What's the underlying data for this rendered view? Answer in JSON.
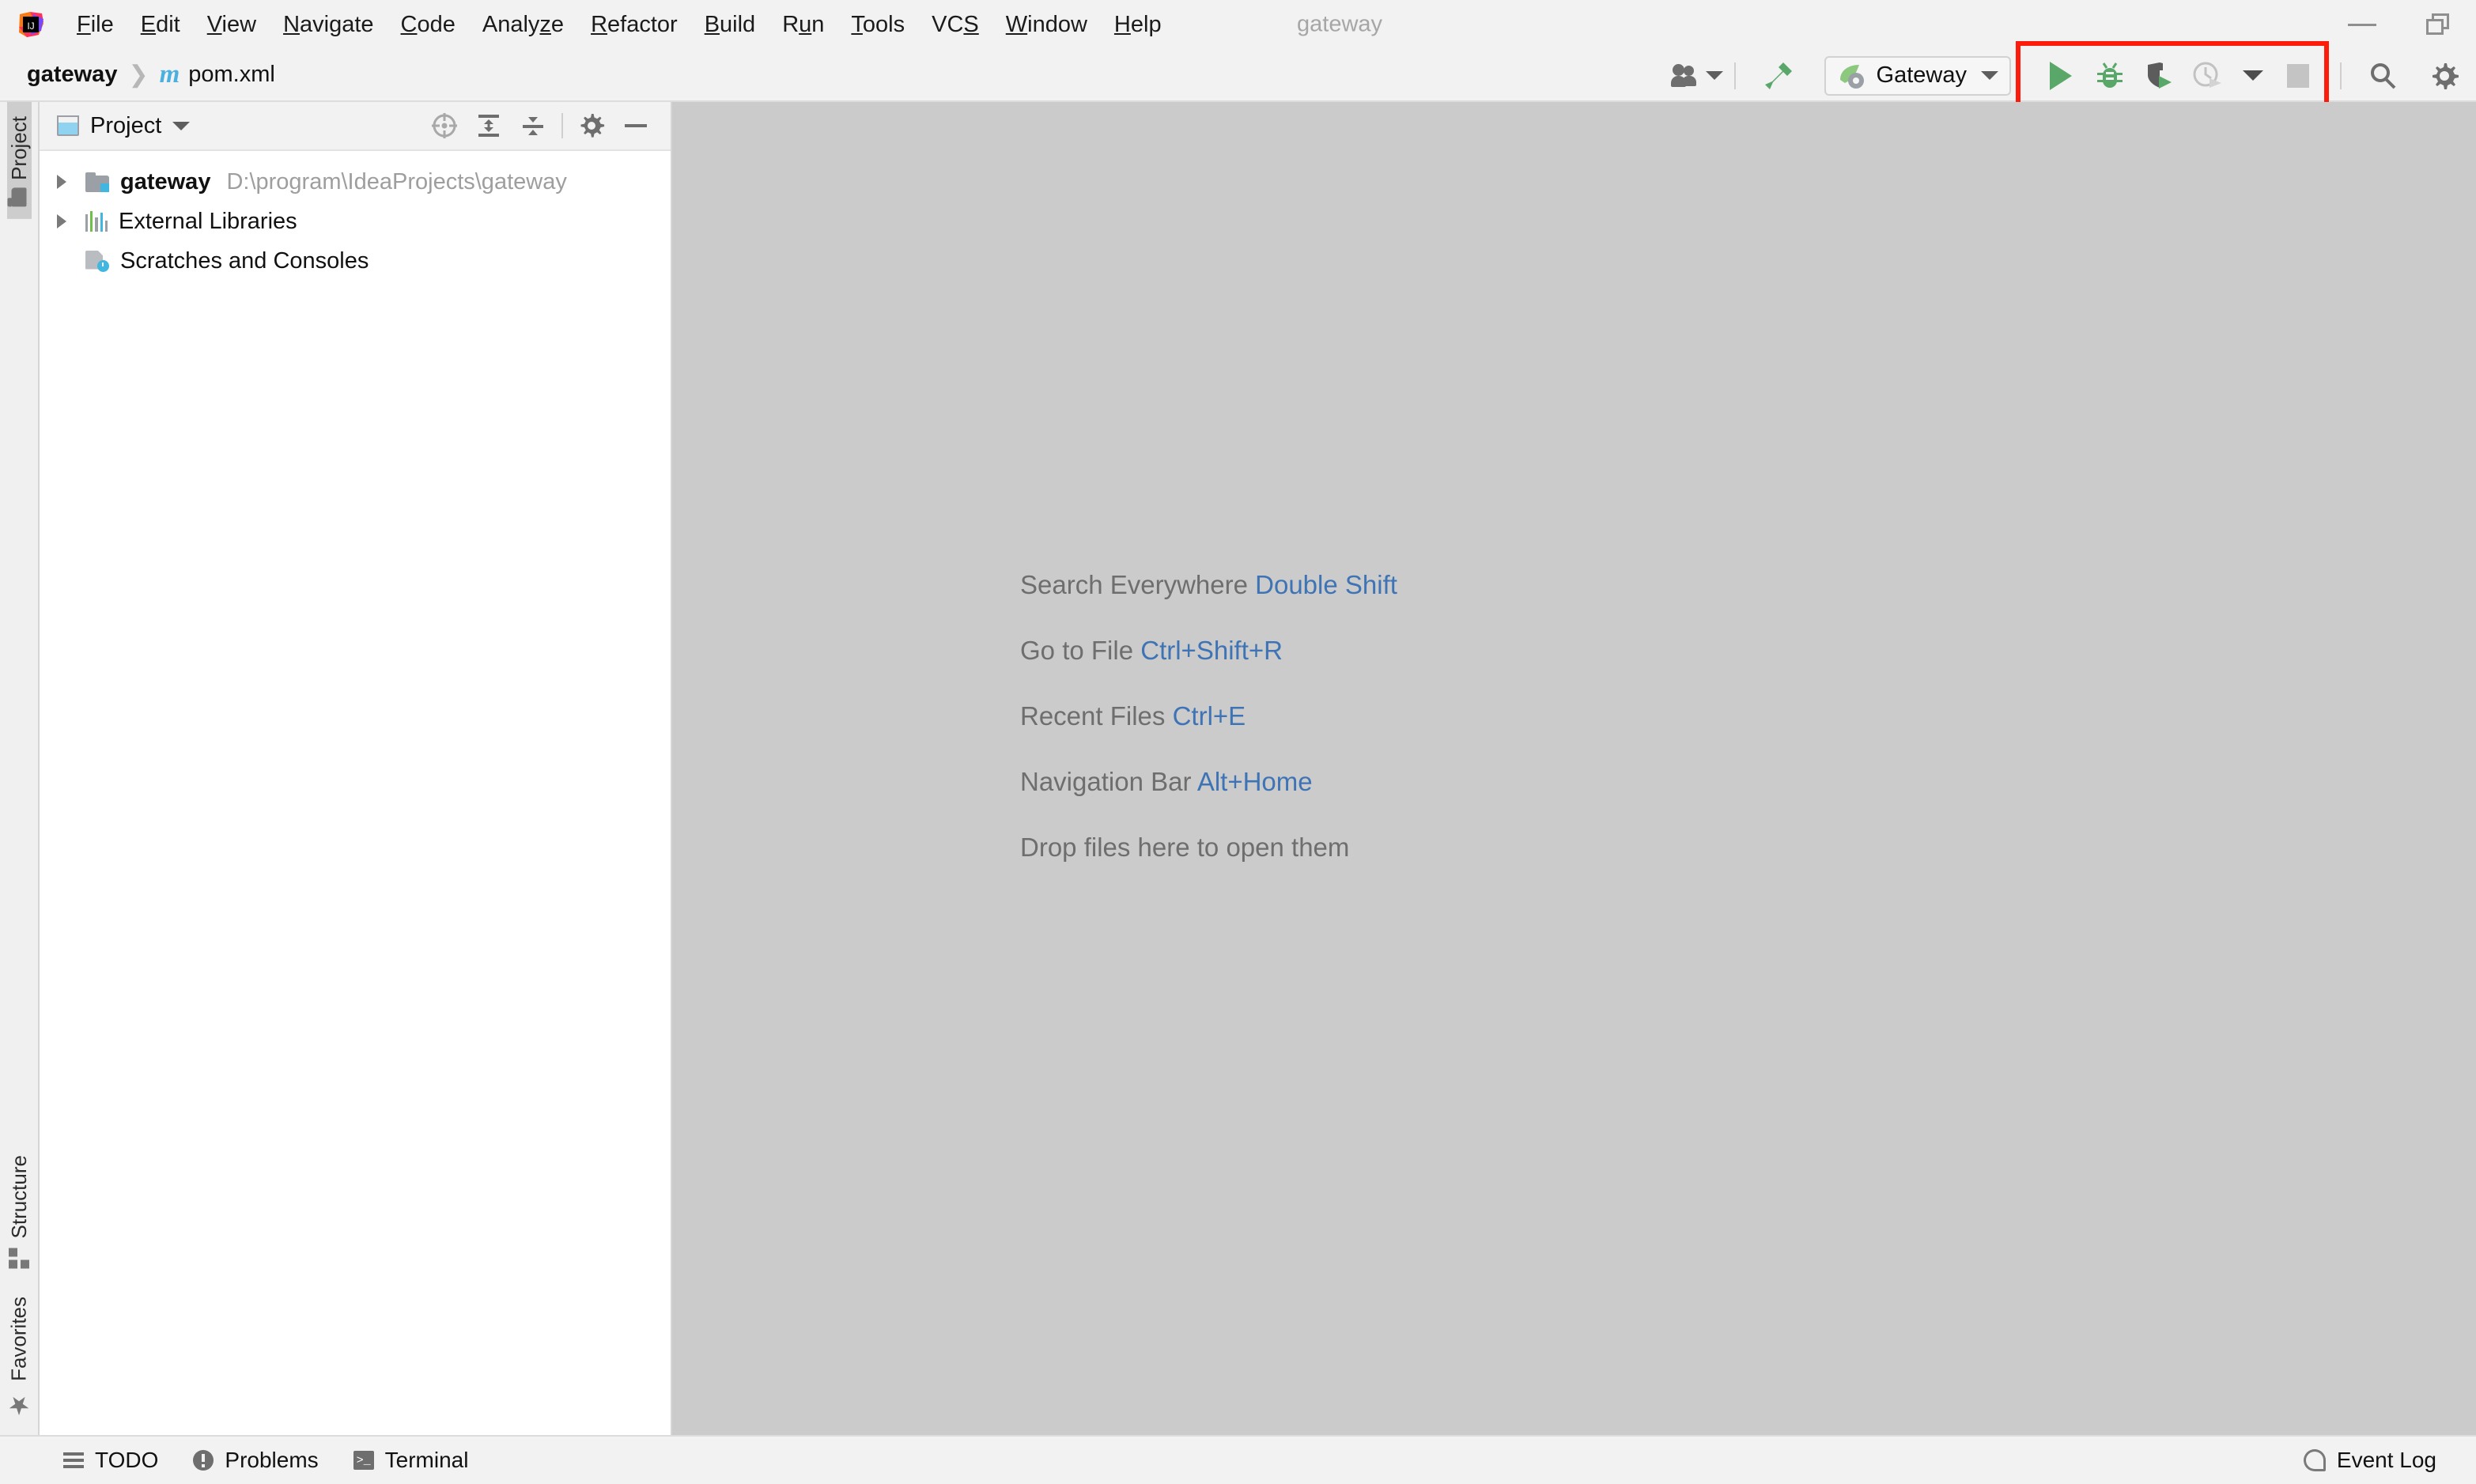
{
  "window": {
    "title": "gateway",
    "controls": [
      {
        "name": "minimize",
        "glyph": "minimize-icon"
      },
      {
        "name": "restore",
        "glyph": "restore-icon"
      }
    ]
  },
  "menubar": {
    "logo_name": "intellij-idea-logo",
    "items": [
      {
        "label": "File",
        "mnemonic": "F"
      },
      {
        "label": "Edit",
        "mnemonic": "E"
      },
      {
        "label": "View",
        "mnemonic": "V"
      },
      {
        "label": "Navigate",
        "mnemonic": "N"
      },
      {
        "label": "Code",
        "mnemonic": "C"
      },
      {
        "label": "Analyze",
        "mnemonic": "z"
      },
      {
        "label": "Refactor",
        "mnemonic": "R"
      },
      {
        "label": "Build",
        "mnemonic": "B"
      },
      {
        "label": "Run",
        "mnemonic": "u"
      },
      {
        "label": "Tools",
        "mnemonic": "T"
      },
      {
        "label": "VCS",
        "mnemonic": "S"
      },
      {
        "label": "Window",
        "mnemonic": "W"
      },
      {
        "label": "Help",
        "mnemonic": "H"
      }
    ]
  },
  "navbar": {
    "breadcrumb": {
      "root": "gateway",
      "separator": "❯",
      "file_badge": "m",
      "file": "pom.xml"
    }
  },
  "toolbar": {
    "vcs_user_icon": "person-group-icon",
    "vcs_user_caret": "chevron-down-icon",
    "build_icon": "hammer-icon",
    "run_config": {
      "icon": "spring-boot-icon",
      "label": "Gateway",
      "caret": "chevron-down-icon"
    },
    "run_controls": {
      "highlighted": true,
      "highlight_color": "#fd1b0b",
      "buttons": [
        {
          "name": "run-button",
          "icon": "play-icon",
          "color": "#59a869",
          "enabled": true
        },
        {
          "name": "debug-button",
          "icon": "bug-icon",
          "color": "#59a869",
          "enabled": true
        },
        {
          "name": "run-with-coverage-button",
          "icon": "coverage-shield-play-icon",
          "color": "#59a869",
          "enabled": true
        },
        {
          "name": "profiler-button",
          "icon": "profiler-clock-icon",
          "color": "#bdbdbd",
          "enabled": false
        },
        {
          "name": "profiler-dropdown",
          "icon": "chevron-down-icon",
          "color": "#5e5e5e",
          "enabled": true
        },
        {
          "name": "stop-button",
          "icon": "stop-square-icon",
          "color": "#c4c4c4",
          "enabled": false
        }
      ]
    },
    "search_icon": "search-icon",
    "settings_icon": "gear-icon"
  },
  "rail": {
    "top": [
      {
        "label": "Project",
        "icon": "folder-icon",
        "active": true
      }
    ],
    "bottom": [
      {
        "label": "Structure",
        "icon": "structure-icon",
        "active": false
      },
      {
        "label": "Favorites",
        "icon": "star-icon",
        "active": false
      }
    ]
  },
  "project_panel": {
    "icon": "project-window-icon",
    "title": "Project",
    "title_caret": "chevron-down-icon",
    "actions": [
      {
        "name": "scroll-from-source-button",
        "icon": "target-icon"
      },
      {
        "name": "expand-all-button",
        "icon": "expand-all-icon"
      },
      {
        "name": "collapse-all-button",
        "icon": "collapse-all-icon"
      },
      {
        "name": "settings-button",
        "icon": "gear-icon"
      },
      {
        "name": "hide-button",
        "icon": "minus-icon"
      }
    ],
    "tree": [
      {
        "label": "gateway",
        "bold": true,
        "hint": "D:\\program\\IdeaProjects\\gateway",
        "icon": "module-folder-icon",
        "arrow": "collapsed",
        "indent": 0
      },
      {
        "label": "External Libraries",
        "bold": false,
        "hint": "",
        "icon": "libraries-icon",
        "arrow": "collapsed",
        "indent": 0
      },
      {
        "label": "Scratches and Consoles",
        "bold": false,
        "hint": "",
        "icon": "scratches-icon",
        "arrow": "none",
        "indent": 0
      }
    ]
  },
  "editor": {
    "background": "#cbcbcb",
    "hints": [
      {
        "action": "Search Everywhere",
        "shortcut": "Double Shift"
      },
      {
        "action": "Go to File",
        "shortcut": "Ctrl+Shift+R"
      },
      {
        "action": "Recent Files",
        "shortcut": "Ctrl+E"
      },
      {
        "action": "Navigation Bar",
        "shortcut": "Alt+Home"
      },
      {
        "action": "Drop files here to open them",
        "shortcut": ""
      }
    ]
  },
  "statusbar": {
    "left": [
      {
        "label": "TODO",
        "icon": "todo-list-icon"
      },
      {
        "label": "Problems",
        "icon": "problems-exclamation-icon"
      },
      {
        "label": "Terminal",
        "icon": "terminal-icon"
      }
    ],
    "right": [
      {
        "label": "Event Log",
        "icon": "event-log-icon"
      }
    ]
  }
}
